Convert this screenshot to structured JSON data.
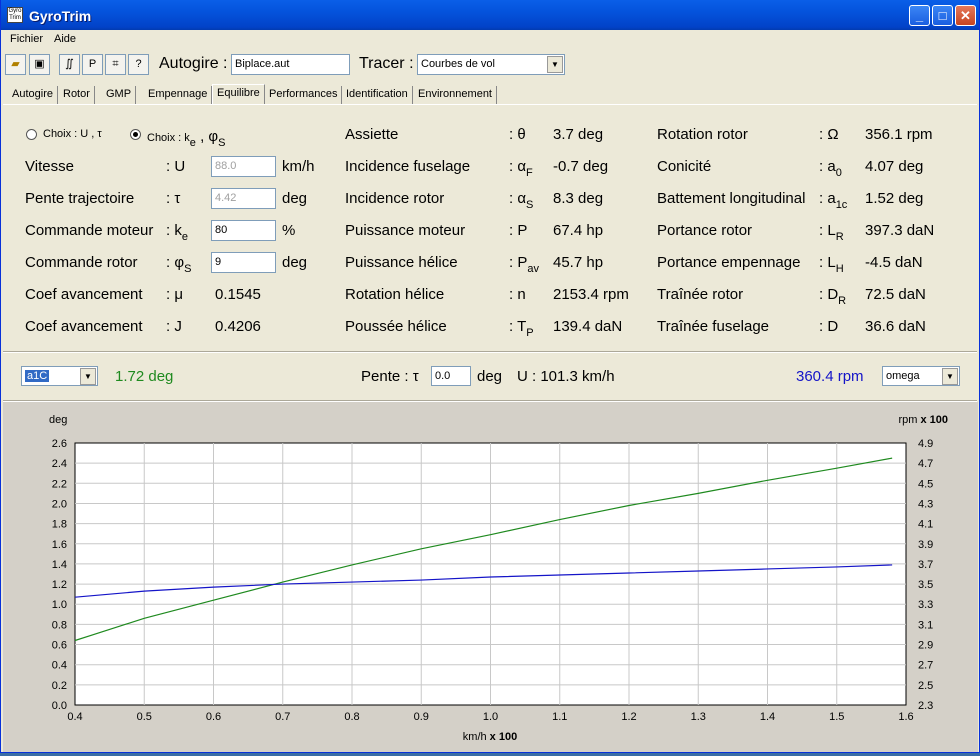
{
  "window": {
    "title": "GyroTrim",
    "icon_text": "Gyro\nTrim"
  },
  "menu": [
    "Fichier",
    "Aide"
  ],
  "toolbar": {
    "btn_p": "P",
    "btn_help": "?",
    "autogire_label": "Autogire :",
    "autogire_value": "Biplace.aut",
    "tracer_label": "Tracer :",
    "tracer_value": "Courbes de vol"
  },
  "tabs": [
    "Autogire",
    "Rotor",
    "GMP",
    "Empennage",
    "Equilibre",
    "Performances",
    "Identification",
    "Environnement"
  ],
  "active_tab": "Equilibre",
  "choice": {
    "opt1": "Choix : U , τ",
    "opt2_a": "Choix : k",
    "opt2_b": "e",
    "opt2_c": " , φ",
    "opt2_d": "S"
  },
  "col1": [
    {
      "name": "Vitesse",
      "sym": ": U",
      "sub": "",
      "val": "88.0",
      "unit": "km/h",
      "disabled": true
    },
    {
      "name": "Pente trajectoire",
      "sym": ": τ",
      "sub": "",
      "val": "4.42",
      "unit": "deg",
      "disabled": true
    },
    {
      "name": "Commande moteur",
      "sym": ": k",
      "sub": "e",
      "val": "80",
      "unit": "%",
      "disabled": false
    },
    {
      "name": "Commande rotor",
      "sym": ": φ",
      "sub": "S",
      "val": "9",
      "unit": "deg",
      "disabled": false
    },
    {
      "name": "Coef avancement",
      "sym": ": μ",
      "sub": "",
      "val": "0.1545"
    },
    {
      "name": "Coef avancement",
      "sym": ": J",
      "sub": "",
      "val": "0.4206"
    }
  ],
  "col2": [
    {
      "name": "Assiette",
      "sym": ": θ",
      "sub": "",
      "val": "3.7 deg"
    },
    {
      "name": "Incidence fuselage",
      "sym": ": α",
      "sub": "F",
      "val": "-0.7 deg"
    },
    {
      "name": "Incidence rotor",
      "sym": ": α",
      "sub": "S",
      "val": "8.3 deg"
    },
    {
      "name": "Puissance moteur",
      "sym": ": P",
      "sub": "",
      "val": "67.4 hp"
    },
    {
      "name": "Puissance hélice",
      "sym": ": P",
      "sub": "av",
      "val": "45.7 hp"
    },
    {
      "name": "Rotation hélice",
      "sym": ": n",
      "sub": "",
      "val": "2153.4 rpm"
    },
    {
      "name": "Poussée hélice",
      "sym": ": T",
      "sub": "P",
      "val": "139.4 daN"
    }
  ],
  "col3": [
    {
      "name": "Rotation  rotor",
      "sym": ": Ω",
      "sub": "",
      "val": "356.1 rpm"
    },
    {
      "name": "Conicité",
      "sym": ": a",
      "sub": "0",
      "val": "4.07 deg"
    },
    {
      "name": "Battement longitudinal",
      "sym": ": a",
      "sub": "1c",
      "val": "1.52 deg"
    },
    {
      "name": "Portance rotor",
      "sym": ": L",
      "sub": "R",
      "val": "397.3 daN"
    },
    {
      "name": "Portance empennage",
      "sym": ": L",
      "sub": "H",
      "val": "-4.5 daN"
    },
    {
      "name": "Traînée rotor",
      "sym": ": D",
      "sub": "R",
      "val": "72.5 daN"
    },
    {
      "name": "Traînée fuselage",
      "sym": ": D",
      "sub": "",
      "val": "36.6 daN"
    }
  ],
  "plotbar": {
    "left_select": "a1C",
    "left_value": "1.72 deg",
    "pente_label": "Pente :",
    "pente_sym": "τ",
    "pente_value": "0.0",
    "pente_unit": "deg",
    "u_text": "U : 101.3 km/h",
    "right_value": "360.4 rpm",
    "right_select": "omega"
  },
  "colors": {
    "green": "#1f8a1f",
    "blue": "#1414c8"
  },
  "chart_data": {
    "type": "line",
    "ylabel_left": "deg",
    "ylabel_right_a": "rpm",
    "ylabel_right_b": " x 100",
    "xlabel_a": "km/h",
    "xlabel_b": " x 100",
    "xlim": [
      0.4,
      1.6
    ],
    "ylim_left": [
      0,
      2.6
    ],
    "ylim_right": [
      2.3,
      4.9
    ],
    "xticks": [
      "0.4",
      "0.5",
      "0.6",
      "0.7",
      "0.8",
      "0.9",
      "1.0",
      "1.1",
      "1.2",
      "1.3",
      "1.4",
      "1.5",
      "1.6"
    ],
    "yticks_left": [
      "0.0",
      "0.2",
      "0.4",
      "0.6",
      "0.8",
      "1.0",
      "1.2",
      "1.4",
      "1.6",
      "1.8",
      "2.0",
      "2.2",
      "2.4",
      "2.6"
    ],
    "yticks_right": [
      "2.3",
      "2.5",
      "2.7",
      "2.9",
      "3.1",
      "3.3",
      "3.5",
      "3.7",
      "3.9",
      "4.1",
      "4.3",
      "4.5",
      "4.7",
      "4.9"
    ],
    "grid": true,
    "series": [
      {
        "axis": "left",
        "color": "#1f8a1f",
        "x": [
          0.4,
          0.5,
          0.6,
          0.7,
          0.8,
          0.9,
          1.0,
          1.1,
          1.2,
          1.3,
          1.4,
          1.5,
          1.58
        ],
        "y": [
          0.64,
          0.86,
          1.04,
          1.22,
          1.39,
          1.55,
          1.69,
          1.84,
          1.98,
          2.1,
          2.23,
          2.35,
          2.45
        ]
      },
      {
        "axis": "right",
        "color": "#1414c8",
        "x": [
          0.4,
          0.5,
          0.6,
          0.7,
          0.8,
          0.9,
          1.0,
          1.1,
          1.2,
          1.3,
          1.4,
          1.5,
          1.58
        ],
        "y": [
          3.37,
          3.43,
          3.47,
          3.5,
          3.52,
          3.54,
          3.57,
          3.59,
          3.61,
          3.63,
          3.65,
          3.67,
          3.69
        ]
      }
    ]
  }
}
